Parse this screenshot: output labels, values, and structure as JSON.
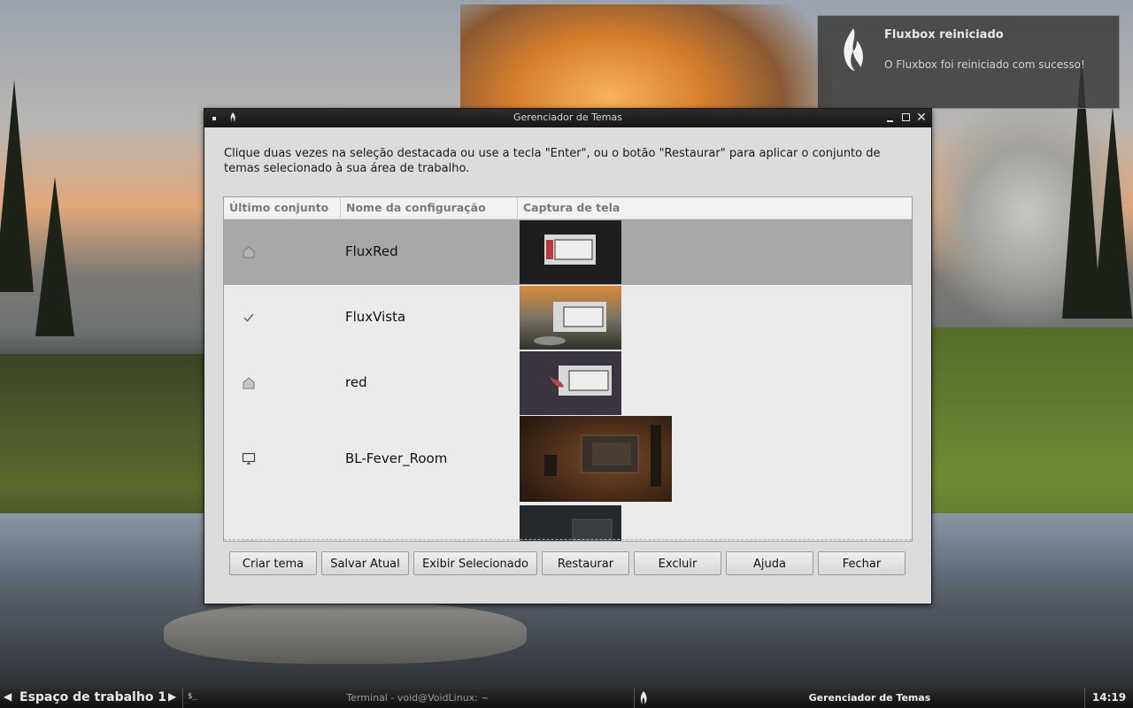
{
  "notification": {
    "title": "Fluxbox reiniciado",
    "body": "O Fluxbox foi reiniciado com sucesso!",
    "icon": "flame-icon"
  },
  "window": {
    "title": "Gerenciador de Temas",
    "description": "Clique duas vezes na seleção destacada ou use a tecla \"Enter\", ou o botão \"Restaurar\" para aplicar o conjunto de temas selecionado à sua área de trabalho.",
    "columns": [
      "Último conjunto",
      "Nome da configuração",
      "Captura de tela"
    ],
    "rows": [
      {
        "name": "FluxRed",
        "icon": "home-icon",
        "selected": true
      },
      {
        "name": "FluxVista",
        "icon": "check-icon",
        "selected": false
      },
      {
        "name": "red",
        "icon": "home-icon",
        "selected": false
      },
      {
        "name": "BL-Fever_Room",
        "icon": "monitor-icon",
        "selected": false
      },
      {
        "name": "",
        "icon": "monitor-icon",
        "selected": false
      }
    ],
    "buttons": {
      "create": "Criar tema",
      "save": "Salvar Atual",
      "show": "Exibir Selecionado",
      "restore": "Restaurar",
      "delete": "Excluir",
      "help": "Ajuda",
      "close": "Fechar"
    }
  },
  "taskbar": {
    "workspace": "Espaço de trabalho 1",
    "terminal": "Terminal - void@VoidLinux: ~",
    "active_app": "Gerenciador de Temas",
    "clock": "14:19"
  }
}
